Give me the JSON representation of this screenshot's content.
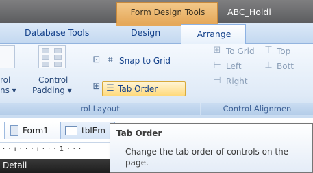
{
  "title_bar": {
    "context_tab_label": "Form Design Tools",
    "document_title": "ABC_Holdi"
  },
  "ribbon_tabs": [
    {
      "label": "Database Tools"
    },
    {
      "label": "Design"
    },
    {
      "label": "Arrange",
      "selected": true
    }
  ],
  "groups": {
    "control_layout": {
      "left_fragment_line1": "rol",
      "left_fragment_line2": "ns ▾",
      "control_padding_line1": "Control",
      "control_padding_line2": "Padding ▾",
      "snap_to_grid": "Snap to Grid",
      "tab_order": "Tab Order",
      "footer": "rol Layout"
    },
    "control_alignment": {
      "to_grid": "To Grid",
      "top": "Top",
      "left": "Left",
      "bottom": "Bott",
      "right": "Right",
      "footer": "Control Alignmen"
    }
  },
  "document_tabs": [
    {
      "label": "Form1",
      "icon": "form-icon"
    },
    {
      "label": "tblEm",
      "icon": "table-icon"
    }
  ],
  "ruler_marks": "· · ı · · · ı · · · 1 · · ·",
  "section_label": "Detail",
  "tooltip": {
    "title": "Tab Order",
    "body": "Change the tab order of controls on the page."
  },
  "colors": {
    "context_tab": "#e5a85a",
    "ribbon_text": "#15428b",
    "selected_button": "#ffd97a"
  }
}
